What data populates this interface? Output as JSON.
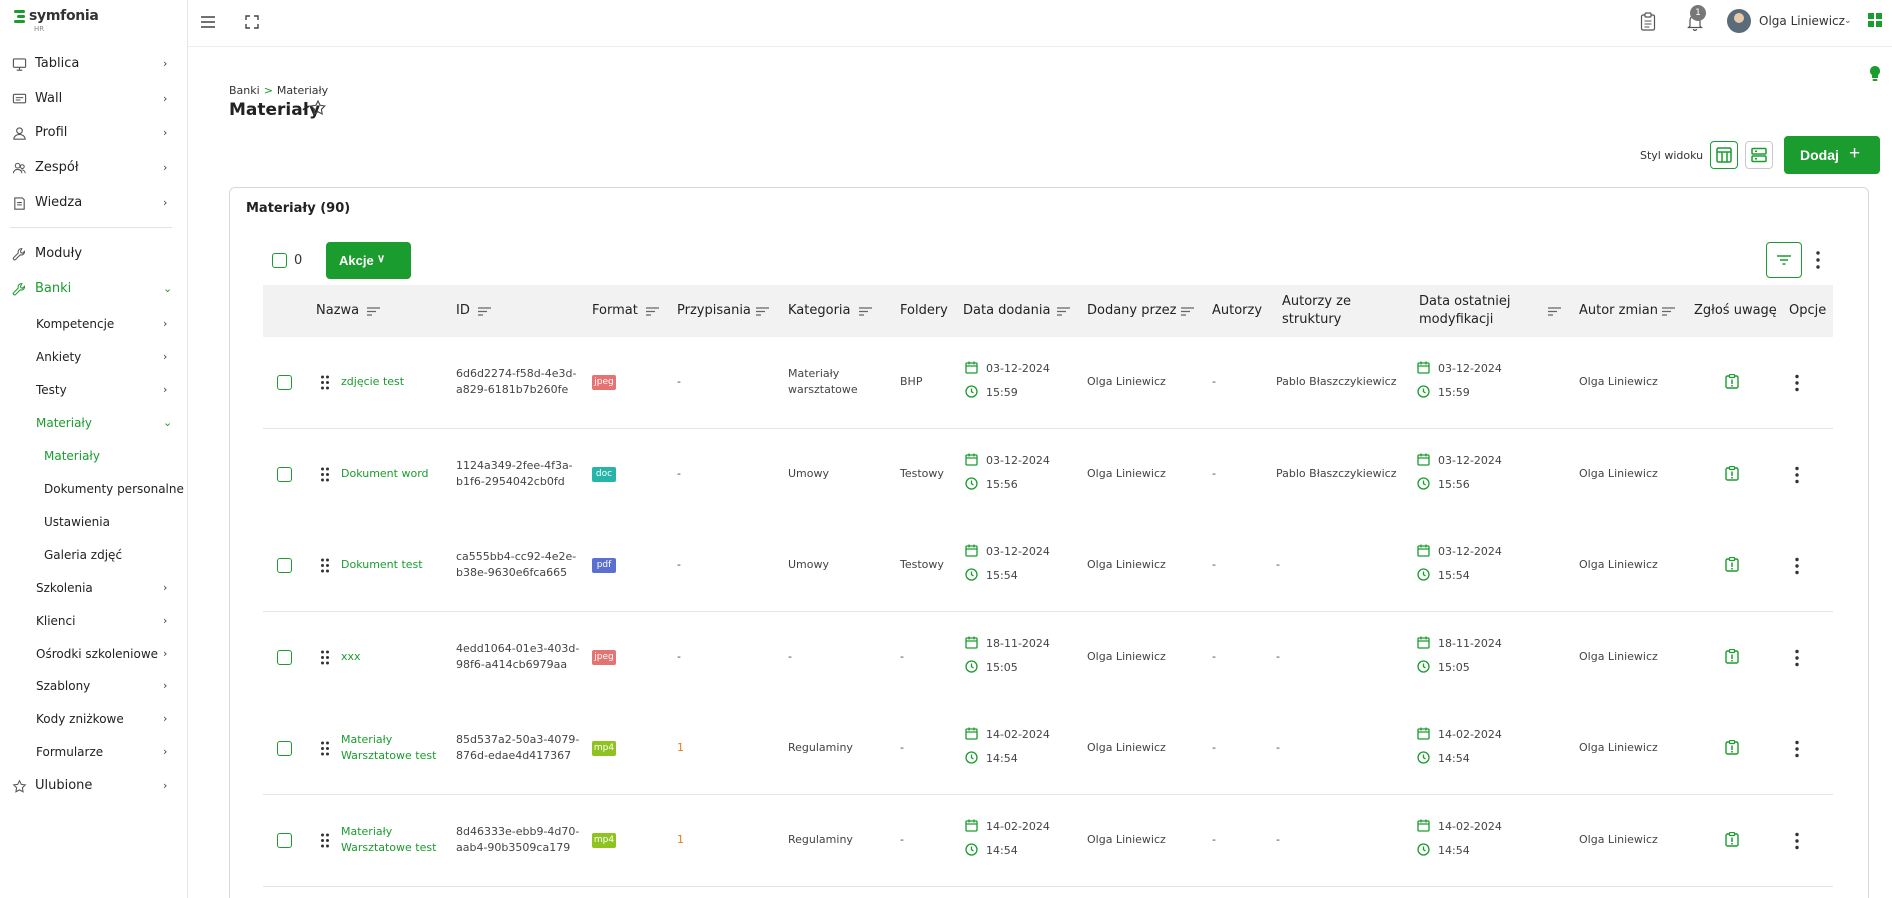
{
  "logo": {
    "name": "symfonia",
    "sub": "HR"
  },
  "sidebar": {
    "top_items": [
      {
        "label": "Tablica",
        "icon": "monitor-icon"
      },
      {
        "label": "Wall",
        "icon": "wall-icon"
      },
      {
        "label": "Profil",
        "icon": "user-icon"
      },
      {
        "label": "Zespół",
        "icon": "team-icon"
      },
      {
        "label": "Wiedza",
        "icon": "book-icon"
      }
    ],
    "modules": {
      "label": "Moduły",
      "icon": "wrench-icon"
    },
    "banks": {
      "label": "Banki",
      "icon": "wrench-icon"
    },
    "bank_items": [
      {
        "label": "Kompetencje"
      },
      {
        "label": "Ankiety"
      },
      {
        "label": "Testy"
      },
      {
        "label": "Materiały"
      }
    ],
    "material_items": [
      {
        "label": "Materiały"
      },
      {
        "label": "Dokumenty personalne"
      },
      {
        "label": "Ustawienia"
      },
      {
        "label": "Galeria zdjęć"
      }
    ],
    "bank_items_after": [
      {
        "label": "Szkolenia"
      },
      {
        "label": "Klienci"
      },
      {
        "label": "Ośrodki szkoleniowe"
      },
      {
        "label": "Szablony"
      },
      {
        "label": "Kody zniżkowe"
      },
      {
        "label": "Formularze"
      }
    ],
    "favorites": {
      "label": "Ulubione",
      "icon": "star-icon"
    }
  },
  "topbar": {
    "notifications_count": "1",
    "user_name": "Olga Liniewicz"
  },
  "breadcrumb": {
    "root": "Banki",
    "separator": ">",
    "current": "Materiały"
  },
  "page_title": "Materiały",
  "view_style_label": "Styl widoku",
  "add_button": {
    "label": "Dodaj",
    "plus": "+"
  },
  "panel_title": "Materiały (90)",
  "selected_count": "0",
  "actions_label": "Akcje",
  "columns": {
    "name": "Nazwa",
    "id": "ID",
    "format": "Format",
    "assignments": "Przypisania",
    "category": "Kategoria",
    "folders": "Foldery",
    "date_added": "Data dodania",
    "added_by": "Dodany przez",
    "authors": "Autorzy",
    "struct_authors_1": "Autorzy ze",
    "struct_authors_2": "struktury",
    "modified_1": "Data ostatniej",
    "modified_2": "modyfikacji",
    "change_author": "Autor zmian",
    "report": "Zgłoś uwagę",
    "options": "Opcje"
  },
  "colors": {
    "accent": "#1a9c2e",
    "jpeg": "#e57373",
    "doc": "#26b5a8",
    "pdf": "#5b6fd1",
    "mp4": "#8fc31f",
    "assign": "#e07d1c"
  },
  "rows": [
    {
      "name1": "zdjęcie test",
      "name2": "",
      "id1": "6d6d2274-f58d-4e3d-",
      "id2": "a829-6181b7b260fe",
      "format": "jpeg",
      "assign": "-",
      "cat1": "Materiały",
      "cat2": "warsztatowe",
      "folder": "BHP",
      "date": "03-12-2024",
      "time": "15:59",
      "added_by": "Olga Liniewicz",
      "authors": "-",
      "struct": "Pablo Błaszczykiewicz",
      "mod_date": "03-12-2024",
      "mod_time": "15:59",
      "change_author": "Olga Liniewicz"
    },
    {
      "name1": "Dokument word",
      "name2": "",
      "id1": "1124a349-2fee-4f3a-",
      "id2": "b1f6-2954042cb0fd",
      "format": "doc",
      "assign": "-",
      "cat1": "Umowy",
      "cat2": "",
      "folder": "Testowy",
      "date": "03-12-2024",
      "time": "15:56",
      "added_by": "Olga Liniewicz",
      "authors": "-",
      "struct": "Pablo Błaszczykiewicz",
      "mod_date": "03-12-2024",
      "mod_time": "15:56",
      "change_author": "Olga Liniewicz"
    },
    {
      "name1": "Dokument test",
      "name2": "",
      "id1": "ca555bb4-cc92-4e2e-",
      "id2": "b38e-9630e6fca665",
      "format": "pdf",
      "assign": "-",
      "cat1": "Umowy",
      "cat2": "",
      "folder": "Testowy",
      "date": "03-12-2024",
      "time": "15:54",
      "added_by": "Olga Liniewicz",
      "authors": "-",
      "struct": "-",
      "mod_date": "03-12-2024",
      "mod_time": "15:54",
      "change_author": "Olga Liniewicz"
    },
    {
      "name1": "xxx",
      "name2": "",
      "id1": "4edd1064-01e3-403d-",
      "id2": "98f6-a414cb6979aa",
      "format": "jpeg",
      "assign": "-",
      "cat1": "-",
      "cat2": "",
      "folder": "-",
      "date": "18-11-2024",
      "time": "15:05",
      "added_by": "Olga Liniewicz",
      "authors": "-",
      "struct": "-",
      "mod_date": "18-11-2024",
      "mod_time": "15:05",
      "change_author": "Olga Liniewicz"
    },
    {
      "name1": "Materiały",
      "name2": "Warsztatowe test",
      "id1": "85d537a2-50a3-4079-",
      "id2": "876d-edae4d417367",
      "format": "mp4",
      "assign": "1",
      "cat1": "Regulaminy",
      "cat2": "",
      "folder": "-",
      "date": "14-02-2024",
      "time": "14:54",
      "added_by": "Olga Liniewicz",
      "authors": "-",
      "struct": "-",
      "mod_date": "14-02-2024",
      "mod_time": "14:54",
      "change_author": "Olga Liniewicz"
    },
    {
      "name1": "Materiały",
      "name2": "Warsztatowe test",
      "id1": "8d46333e-ebb9-4d70-",
      "id2": "aab4-90b3509ca179",
      "format": "mp4",
      "assign": "1",
      "cat1": "Regulaminy",
      "cat2": "",
      "folder": "-",
      "date": "14-02-2024",
      "time": "14:54",
      "added_by": "Olga Liniewicz",
      "authors": "-",
      "struct": "-",
      "mod_date": "14-02-2024",
      "mod_time": "14:54",
      "change_author": "Olga Liniewicz"
    }
  ]
}
